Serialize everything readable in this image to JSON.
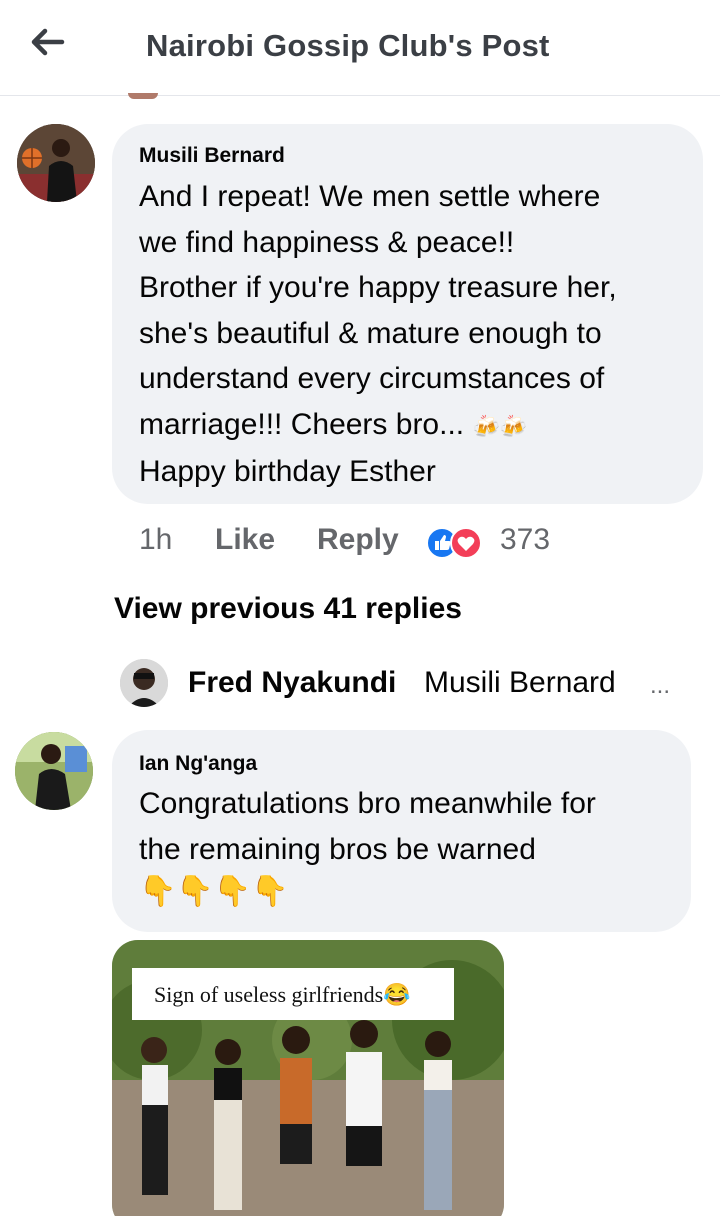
{
  "header": {
    "title": "Nairobi Gossip Club's Post",
    "back_icon": "arrow-left-icon"
  },
  "comment1": {
    "author": "Musili Bernard",
    "lines": [
      "And I repeat! We men settle where",
      "we find happiness & peace!!",
      "Brother if you're happy treasure her,",
      "she's beautiful & mature enough to",
      "understand every circumstances of",
      "marriage!!! Cheers bro...",
      "Happy birthday Esther"
    ],
    "emoji": "🍻🍻",
    "time": "1h",
    "like_label": "Like",
    "reply_label": "Reply",
    "reaction_count": "373",
    "reaction_icons": [
      "like-reaction-icon",
      "love-reaction-icon"
    ],
    "colors": {
      "like": "#1877f2",
      "love": "#f33e58"
    }
  },
  "view_previous": "View previous 41 replies",
  "reply_preview": {
    "author": "Fred Nyakundi",
    "text": "Musili Bernard",
    "ellipsis": "..."
  },
  "comment2": {
    "author": "Ian Ng'anga",
    "lines": [
      "Congratulations bro meanwhile for",
      "the remaining bros be warned"
    ],
    "emoji": "👇👇👇👇"
  },
  "photo": {
    "caption": "Sign of useless girlfriends",
    "caption_emoji": "😂"
  }
}
